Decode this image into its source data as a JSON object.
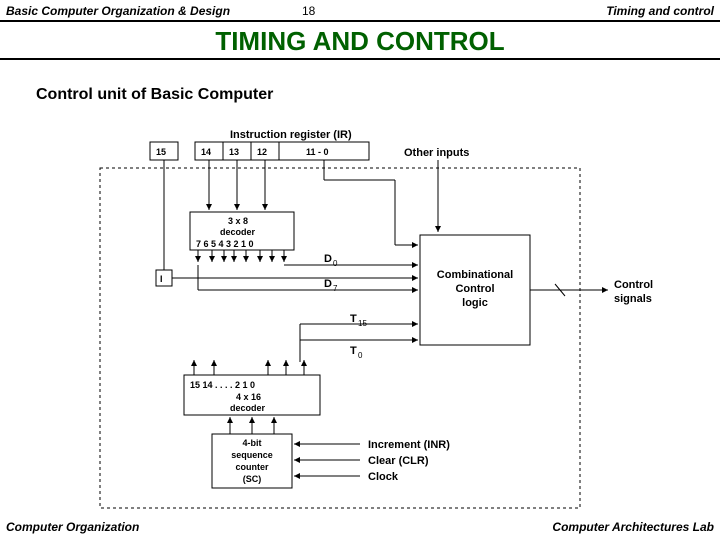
{
  "header": {
    "left": "Basic Computer Organization & Design",
    "page": "18",
    "right": "Timing and control"
  },
  "title": "TIMING  AND  CONTROL",
  "subtitle": "Control unit of Basic Computer",
  "footer": {
    "left": "Computer Organization",
    "right": "Computer Architectures Lab"
  },
  "diagram": {
    "ir_label": "Instruction register (IR)",
    "ir_bits": {
      "b15": "15",
      "b14": "14",
      "b13": "13",
      "b12": "12",
      "range": "11 - 0"
    },
    "other_inputs": "Other inputs",
    "decoder38": {
      "title": "3 x 8",
      "sub": "decoder",
      "outs": "7  6 5 4 3  2 1 0"
    },
    "i_flag": "I",
    "d_outs": {
      "d0": "D",
      "d0s": "0",
      "d7": "D",
      "d7s": "7"
    },
    "ccl": {
      "l1": "Combinational",
      "l2": "Control",
      "l3": "logic"
    },
    "control_signals": {
      "l1": "Control",
      "l2": "signals"
    },
    "t_outs": {
      "t15": "T",
      "t15s": "15",
      "t0": "T",
      "t0s": "0"
    },
    "decoder416": {
      "bits": "15  14  . . . .   2  1  0",
      "title": "4 x 16",
      "sub": "decoder"
    },
    "sc": {
      "l1": "4-bit",
      "l2": "sequence",
      "l3": "counter",
      "l4": "(SC)"
    },
    "sc_in": {
      "inr": "Increment (INR)",
      "clr": "Clear (CLR)",
      "clk": "Clock"
    }
  }
}
